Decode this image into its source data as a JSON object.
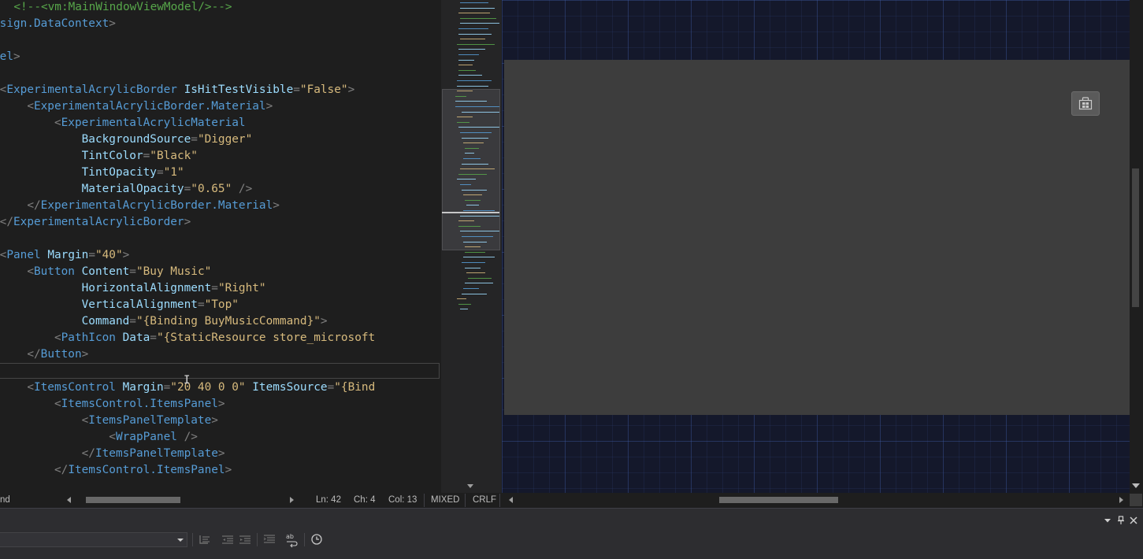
{
  "colors": {
    "editor_bg": "#1e1e1e",
    "comment": "#57a64a",
    "tag": "#569cd6",
    "attribute": "#9cdcfe",
    "value": "#d7ba7d",
    "punctuation": "#808080",
    "designer_canvas": "#14182b",
    "preview_window": "#3d3d3d",
    "status_text": "#bcbcbc"
  },
  "editor": {
    "lines": [
      [
        [
          "cm",
          "  <!--<vm:MainWindowViewModel/>-->"
        ]
      ],
      [
        [
          "tag",
          "esign.DataContext"
        ],
        [
          "punc",
          ">"
        ]
      ],
      [
        [
          "text",
          ""
        ]
      ],
      [
        [
          "tag",
          "nel"
        ],
        [
          "punc",
          ">"
        ]
      ],
      [
        [
          "text",
          ""
        ]
      ],
      [
        [
          "punc",
          " <"
        ],
        [
          "tag",
          "ExperimentalAcrylicBorder"
        ],
        [
          "text",
          " "
        ],
        [
          "attr",
          "IsHitTestVisible"
        ],
        [
          "punc",
          "="
        ],
        [
          "val",
          "\"False\""
        ],
        [
          "punc",
          ">"
        ]
      ],
      [
        [
          "punc",
          "     <"
        ],
        [
          "tag",
          "ExperimentalAcrylicBorder.Material"
        ],
        [
          "punc",
          ">"
        ]
      ],
      [
        [
          "punc",
          "         <"
        ],
        [
          "tag",
          "ExperimentalAcrylicMaterial"
        ]
      ],
      [
        [
          "text",
          "             "
        ],
        [
          "attr",
          "BackgroundSource"
        ],
        [
          "punc",
          "="
        ],
        [
          "val",
          "\"Digger\""
        ]
      ],
      [
        [
          "text",
          "             "
        ],
        [
          "attr",
          "TintColor"
        ],
        [
          "punc",
          "="
        ],
        [
          "val",
          "\"Black\""
        ]
      ],
      [
        [
          "text",
          "             "
        ],
        [
          "attr",
          "TintOpacity"
        ],
        [
          "punc",
          "="
        ],
        [
          "val",
          "\"1\""
        ]
      ],
      [
        [
          "text",
          "             "
        ],
        [
          "attr",
          "MaterialOpacity"
        ],
        [
          "punc",
          "="
        ],
        [
          "val",
          "\"0.65\""
        ],
        [
          "punc",
          " />"
        ]
      ],
      [
        [
          "punc",
          "     </"
        ],
        [
          "tag",
          "ExperimentalAcrylicBorder.Material"
        ],
        [
          "punc",
          ">"
        ]
      ],
      [
        [
          "punc",
          " </"
        ],
        [
          "tag",
          "ExperimentalAcrylicBorder"
        ],
        [
          "punc",
          ">"
        ]
      ],
      [
        [
          "text",
          ""
        ]
      ],
      [
        [
          "punc",
          " <"
        ],
        [
          "tag",
          "Panel"
        ],
        [
          "text",
          " "
        ],
        [
          "attr",
          "Margin"
        ],
        [
          "punc",
          "="
        ],
        [
          "val",
          "\"40\""
        ],
        [
          "punc",
          ">"
        ]
      ],
      [
        [
          "punc",
          "     <"
        ],
        [
          "tag",
          "Button"
        ],
        [
          "text",
          " "
        ],
        [
          "attr",
          "Content"
        ],
        [
          "punc",
          "="
        ],
        [
          "val",
          "\"Buy Music\""
        ]
      ],
      [
        [
          "text",
          "             "
        ],
        [
          "attr",
          "HorizontalAlignment"
        ],
        [
          "punc",
          "="
        ],
        [
          "val",
          "\"Right\""
        ]
      ],
      [
        [
          "text",
          "             "
        ],
        [
          "attr",
          "VerticalAlignment"
        ],
        [
          "punc",
          "="
        ],
        [
          "val",
          "\"Top\""
        ]
      ],
      [
        [
          "text",
          "             "
        ],
        [
          "attr",
          "Command"
        ],
        [
          "punc",
          "="
        ],
        [
          "val",
          "\"{Binding BuyMusicCommand}\""
        ],
        [
          "punc",
          ">"
        ]
      ],
      [
        [
          "punc",
          "         <"
        ],
        [
          "tag",
          "PathIcon"
        ],
        [
          "text",
          " "
        ],
        [
          "attr",
          "Data"
        ],
        [
          "punc",
          "="
        ],
        [
          "val",
          "\"{StaticResource store_microsoft"
        ]
      ],
      [
        [
          "punc",
          "     </"
        ],
        [
          "tag",
          "Button"
        ],
        [
          "punc",
          ">"
        ]
      ],
      [
        [
          "text",
          ""
        ]
      ],
      [
        [
          "punc",
          "     <"
        ],
        [
          "tag",
          "ItemsControl"
        ],
        [
          "text",
          " "
        ],
        [
          "attr",
          "Margin"
        ],
        [
          "punc",
          "="
        ],
        [
          "val",
          "\"20 40 0 0\""
        ],
        [
          "text",
          " "
        ],
        [
          "attr",
          "ItemsSource"
        ],
        [
          "punc",
          "="
        ],
        [
          "val",
          "\"{Bind"
        ]
      ],
      [
        [
          "punc",
          "         <"
        ],
        [
          "tag",
          "ItemsControl.ItemsPanel"
        ],
        [
          "punc",
          ">"
        ]
      ],
      [
        [
          "punc",
          "             <"
        ],
        [
          "tag",
          "ItemsPanelTemplate"
        ],
        [
          "punc",
          ">"
        ]
      ],
      [
        [
          "punc",
          "                 <"
        ],
        [
          "tag",
          "WrapPanel"
        ],
        [
          "punc",
          " />"
        ]
      ],
      [
        [
          "punc",
          "             </"
        ],
        [
          "tag",
          "ItemsPanelTemplate"
        ],
        [
          "punc",
          ">"
        ]
      ],
      [
        [
          "punc",
          "         </"
        ],
        [
          "tag",
          "ItemsControl.ItemsPanel"
        ],
        [
          "punc",
          ">"
        ]
      ]
    ],
    "cursor_glyph": "I"
  },
  "status": {
    "left_fragment": "nd",
    "ln": "Ln: 42",
    "ch": "Ch: 4",
    "col": "Col: 13",
    "encoding_mode": "MIXED",
    "line_ending": "CRLF",
    "editor_hscroll_position": 0.1,
    "designer_hscroll_position": 0.42
  },
  "icons": {
    "buy_music": "store-icon",
    "panel_menu": "chevron-down-icon",
    "pin": "pin-icon",
    "close": "close-icon",
    "toolbar": [
      "outdent-icon",
      "decrease-indent-icon",
      "increase-indent-icon",
      "format-icon",
      "word-wrap-icon",
      "history-icon"
    ]
  }
}
